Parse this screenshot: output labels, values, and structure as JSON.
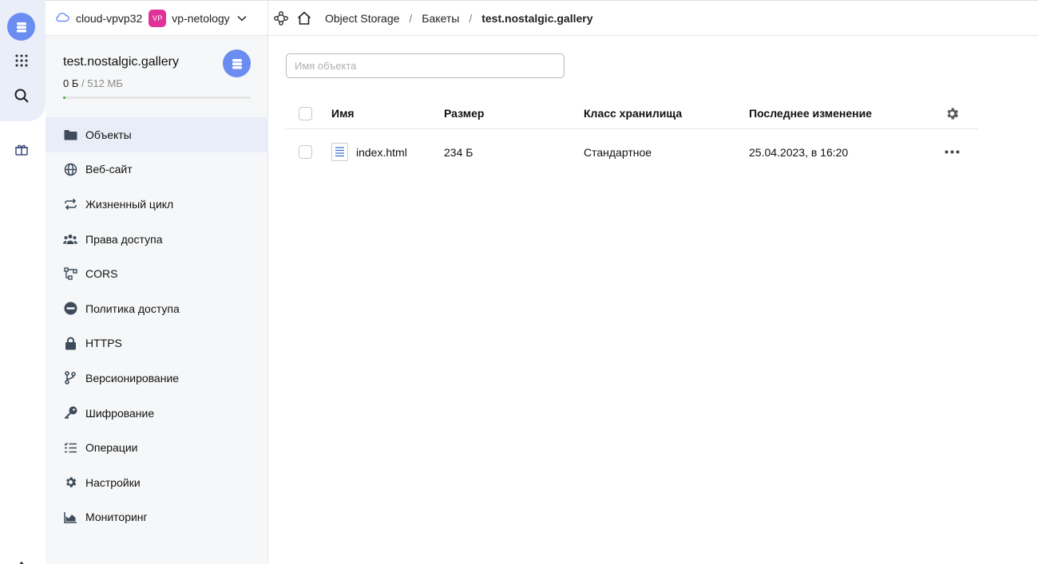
{
  "header": {
    "cloud_name": "cloud-vpvp32",
    "folder_badge": "VP",
    "folder_name": "vp-netology",
    "breadcrumbs": [
      "Object Storage",
      "Бакеты",
      "test.nostalgic.gallery"
    ],
    "separator": "/"
  },
  "bucket": {
    "name": "test.nostalgic.gallery",
    "used": "0 Б",
    "limit": "/ 512 МБ",
    "usage_fraction": 0.005
  },
  "sidebar": {
    "items": [
      {
        "label": "Объекты",
        "icon": "folder-icon",
        "active": true
      },
      {
        "label": "Веб-сайт",
        "icon": "globe-icon"
      },
      {
        "label": "Жизненный цикл",
        "icon": "cycle-icon"
      },
      {
        "label": "Права доступа",
        "icon": "users-icon"
      },
      {
        "label": "CORS",
        "icon": "cors-icon"
      },
      {
        "label": "Политика доступа",
        "icon": "policy-icon"
      },
      {
        "label": "HTTPS",
        "icon": "lock-icon"
      },
      {
        "label": "Версионирование",
        "icon": "branch-icon"
      },
      {
        "label": "Шифрование",
        "icon": "key-icon"
      },
      {
        "label": "Операции",
        "icon": "list-icon"
      },
      {
        "label": "Настройки",
        "icon": "gear-icon"
      },
      {
        "label": "Мониторинг",
        "icon": "chart-icon"
      }
    ]
  },
  "search": {
    "placeholder": "Имя объекта",
    "value": ""
  },
  "table": {
    "columns": [
      "Имя",
      "Размер",
      "Класс хранилища",
      "Последнее изменение"
    ],
    "rows": [
      {
        "name": "index.html",
        "size": "234 Б",
        "storage_class": "Стандартное",
        "modified": "25.04.2023, в 16:20"
      }
    ]
  },
  "colors": {
    "accent": "#6b8cf0",
    "badge": "#e0339a",
    "usage": "#4db04a",
    "icon": "#3d4b5c"
  }
}
